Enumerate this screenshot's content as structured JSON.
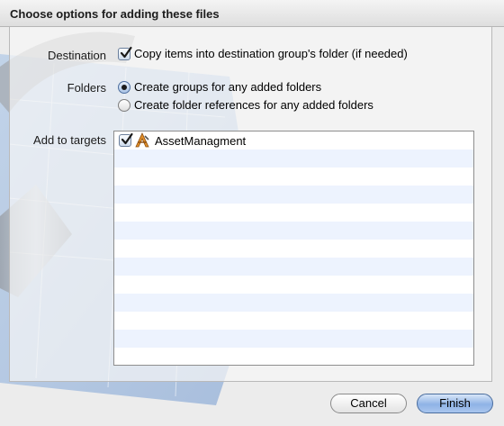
{
  "sheet": {
    "title": "Choose options for adding these files"
  },
  "destination": {
    "label": "Destination",
    "copy_items_label": "Copy items into destination group's folder (if needed)",
    "copy_items_checked": true
  },
  "folders": {
    "label": "Folders",
    "options": [
      {
        "label": "Create groups for any added folders",
        "selected": true
      },
      {
        "label": "Create folder references for any added folders",
        "selected": false
      }
    ]
  },
  "targets": {
    "label": "Add to targets",
    "items": [
      {
        "name": "AssetManagment",
        "checked": true,
        "icon": "app-target-icon"
      }
    ]
  },
  "buttons": {
    "cancel": "Cancel",
    "finish": "Finish"
  },
  "colors": {
    "accent": "#8fb3e6",
    "list_stripe": "#edf3fe"
  }
}
